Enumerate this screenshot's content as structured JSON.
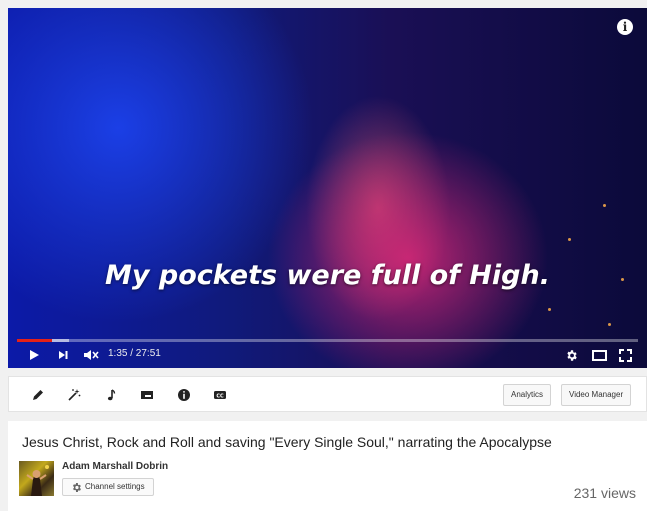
{
  "player": {
    "caption": "My pockets were full of High.",
    "info_icon": "info-icon",
    "time_current": "1:35",
    "time_total": "27:51",
    "time_display": "1:35 / 27:51",
    "progress_played": 0.057,
    "progress_buffered": 0.083,
    "accent_color": "#e62117",
    "controls": {
      "play_icon": "play-icon",
      "next_icon": "next-icon",
      "volume_icon": "volume-muted-icon",
      "settings_icon": "gear-icon",
      "theater_icon": "theater-mode-icon",
      "fullscreen_icon": "fullscreen-icon"
    }
  },
  "toolbar": {
    "tools": [
      "pencil-icon",
      "magic-wand-icon",
      "music-note-icon",
      "annotation-icon",
      "info-icon",
      "cc-icon"
    ],
    "analytics_label": "Analytics",
    "video_manager_label": "Video Manager"
  },
  "video": {
    "title": "Jesus Christ, Rock and Roll and saving \"Every Single Soul,\" narrating the Apocalypse",
    "channel_name": "Adam Marshall Dobrin",
    "channel_settings_label": "Channel settings",
    "views": "231 views"
  }
}
